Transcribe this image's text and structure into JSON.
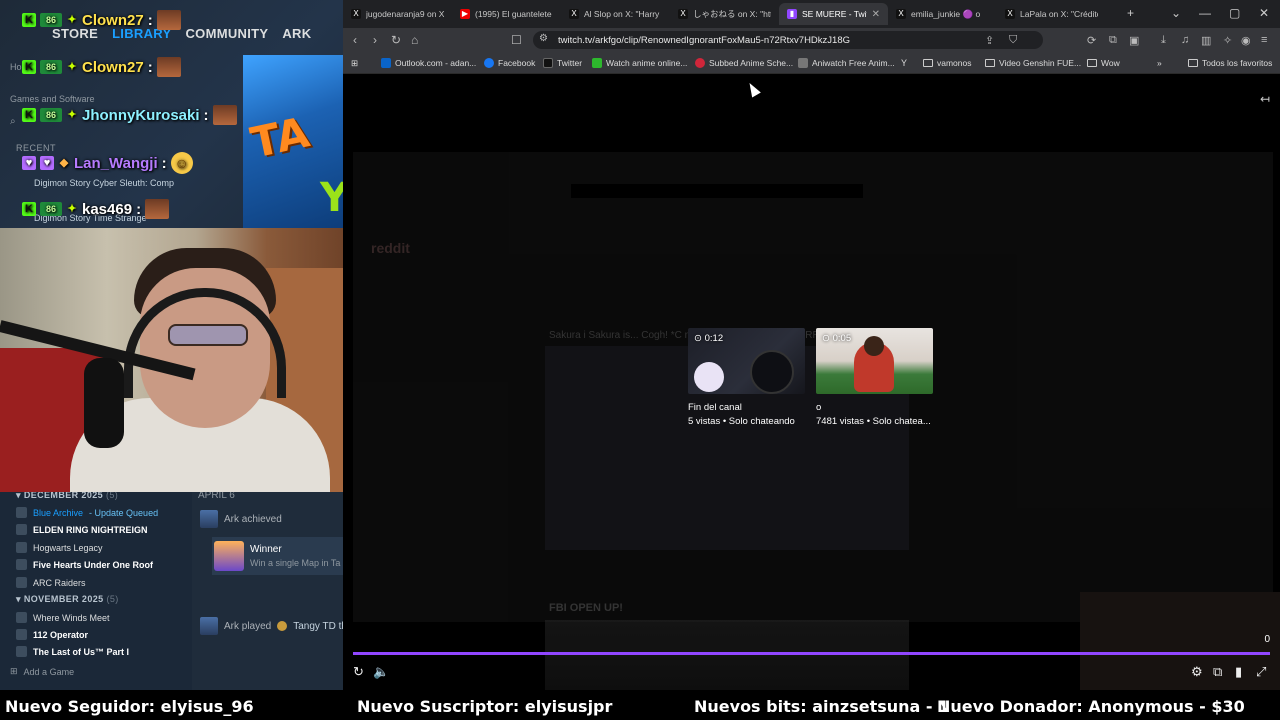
{
  "steam": {
    "nav": [
      "STORE",
      "LIBRARY",
      "COMMUNITY",
      "ARK"
    ],
    "nav_active": "LIBRARY",
    "side_label": "Games and Software",
    "recent_label": "RECENT",
    "recent_items": [
      "Digimon Story Cyber Sleuth: Comp",
      "Digimon Story Time Strange"
    ],
    "home_stub": "Hor",
    "sections": [
      {
        "title": "DECEMBER 2025",
        "count": "(5)",
        "items": [
          {
            "label": "Blue Archive",
            "suffix": " - Update Queued",
            "style": "blue"
          },
          {
            "label": "ELDEN RING NIGHTREIGN",
            "style": "bold"
          },
          {
            "label": "Hogwarts Legacy",
            "style": "normal"
          },
          {
            "label": "Five Hearts Under One Roof",
            "style": "bold"
          },
          {
            "label": "ARC Raiders",
            "style": "normal"
          }
        ]
      },
      {
        "title": "NOVEMBER 2025",
        "count": "(5)",
        "items": [
          {
            "label": "Where Winds Meet",
            "style": "normal"
          },
          {
            "label": "112 Operator",
            "style": "bold"
          },
          {
            "label": "The Last of Us™ Part I",
            "style": "bold"
          }
        ]
      }
    ],
    "add_game": "Add a Game",
    "activity": {
      "date": "APRIL 6",
      "achieved": "Ark achieved",
      "ach_title": "Winner",
      "ach_desc": "Win a single Map in Ta",
      "played": "Ark played",
      "played_game": "Tangy TD th"
    }
  },
  "chat": [
    {
      "user": "Clown27",
      "sep": ":",
      "color": "yellow"
    },
    {
      "user": "Clown27",
      "sep": ":",
      "color": "yellow"
    },
    {
      "user": "JhonnyKurosaki",
      "sep": ":",
      "color": "cyan"
    },
    {
      "user": "Lan_Wangji",
      "sep": ":",
      "color": "purple"
    },
    {
      "user": "kas469",
      "sep": ":",
      "color": "white"
    }
  ],
  "browser": {
    "tabs": [
      {
        "title": "jugodenaranja9 on X:",
        "icon": "x"
      },
      {
        "title": "(1995) El guantelete p",
        "icon": "youtube"
      },
      {
        "title": "Al Slop on X: \"Harry P",
        "icon": "x"
      },
      {
        "title": "しゃおねる on X: \"https:",
        "icon": "x"
      },
      {
        "title": "SE MUERE - Twitch",
        "icon": "twitch",
        "active": true
      },
      {
        "title": "emilia_junkie 🟣 o",
        "icon": "x"
      },
      {
        "title": "LaPala on X: \"Crédito",
        "icon": "x"
      }
    ],
    "url": "twitch.tv/arkfgo/clip/RenownedIgnorantFoxMau5-n72Rtxv7HDkzJ18G",
    "bookmarks": [
      {
        "label": "Outlook.com - adan...",
        "color": "#0a64c8"
      },
      {
        "label": "Facebook",
        "color": "#1877f2"
      },
      {
        "label": "Twitter",
        "color": "#111111"
      },
      {
        "label": "Watch anime online...",
        "color": "#2db82d"
      },
      {
        "label": "Subbed Anime Sche...",
        "color": "#d0263a"
      },
      {
        "label": "Aniwatch Free Anim...",
        "color": "#777777"
      },
      {
        "label": "vamonos",
        "color": "folder"
      },
      {
        "label": "Video Genshin FUE...",
        "color": "folder"
      },
      {
        "label": "Wow",
        "color": "folder"
      }
    ],
    "all_bookmarks": "Todos los favoritos"
  },
  "video": {
    "recommendations": [
      {
        "duration": "0:12",
        "title": "Fin del canal",
        "views": "5 vistas • Solo chateando"
      },
      {
        "duration": "0:05",
        "title": "o",
        "views": "7481 vistas • Solo chatea..."
      }
    ],
    "counter": "0",
    "progress": 1.0,
    "ghost": {
      "site": "reddit",
      "post_title": "Sakura i Sakura is... Cogh! *C muere* VER EN EL ALTERRRR",
      "post2": "FBI OPEN UP!"
    }
  },
  "ticker": [
    "Nuevo Seguidor: elyisus_96",
    "Nuevo Suscriptor: elyisusjpr",
    "Nuevos bits: ainzsetsuna - 1",
    "Nuevo Donador: Anonymous - $30"
  ]
}
